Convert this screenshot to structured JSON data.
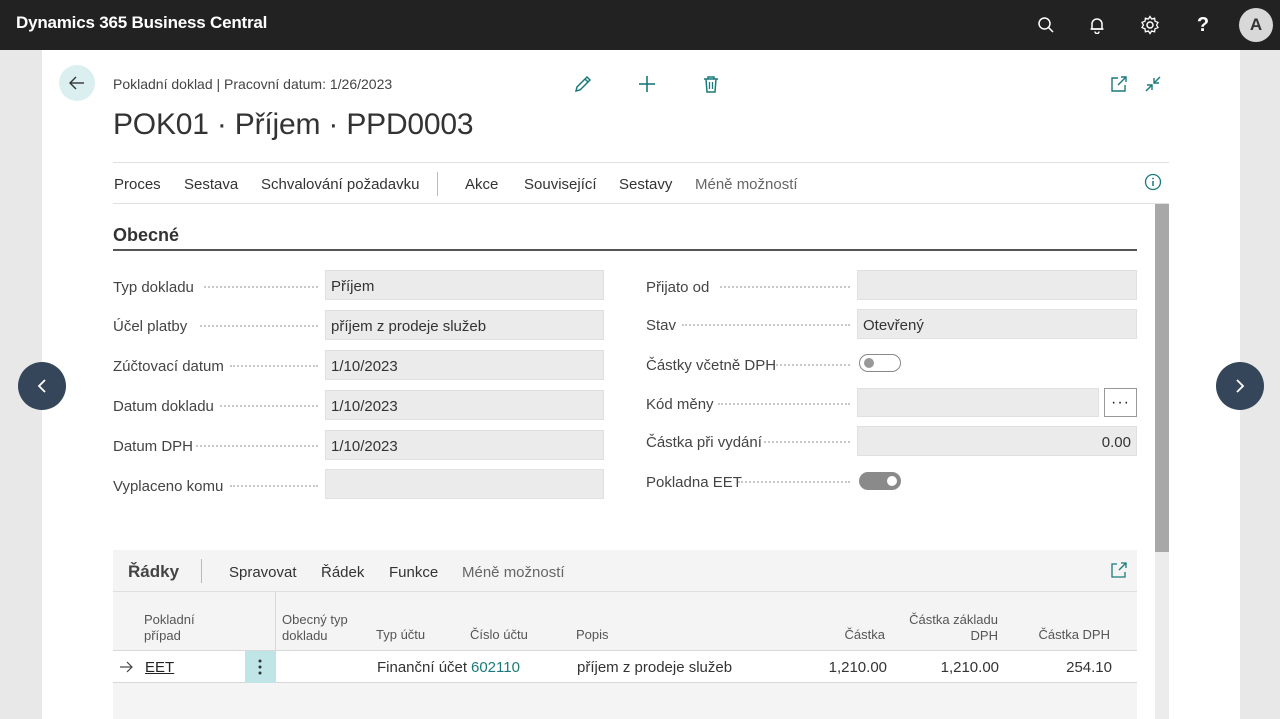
{
  "app": {
    "title": "Dynamics 365 Business Central",
    "avatar_initial": "A"
  },
  "topbar_icons": [
    "search-icon",
    "bell-icon",
    "gear-icon",
    "help-icon"
  ],
  "page": {
    "caption": "Pokladní doklad | Pracovní datum: 1/26/2023",
    "title": "POK01 · Příjem · PPD0003"
  },
  "actions": {
    "menu": [
      "Proces",
      "Sestava",
      "Schvalování požadavku",
      "Akce",
      "Související",
      "Sestavy",
      "Méně možností"
    ]
  },
  "general": {
    "section_title": "Obecné",
    "left_fields": [
      {
        "label": "Typ dokladu",
        "value": "Příjem"
      },
      {
        "label": "Účel platby",
        "value": "příjem z prodeje služeb"
      },
      {
        "label": "Zúčtovací datum",
        "value": "1/10/2023"
      },
      {
        "label": "Datum dokladu",
        "value": "1/10/2023"
      },
      {
        "label": "Datum DPH",
        "value": "1/10/2023"
      },
      {
        "label": "Vyplaceno komu",
        "value": ""
      }
    ],
    "right_fields": [
      {
        "label": "Přijato od",
        "value": ""
      },
      {
        "label": "Stav",
        "value": "Otevřený"
      },
      {
        "label": "Částky včetně DPH",
        "toggle": false
      },
      {
        "label": "Kód měny",
        "value": "",
        "ellipsis": "···"
      },
      {
        "label": "Částka při vydání",
        "value": "0.00"
      },
      {
        "label": "Pokladna EET",
        "toggle": true
      }
    ]
  },
  "lines": {
    "title": "Řádky",
    "menu": [
      "Spravovat",
      "Řádek",
      "Funkce",
      "Méně možností"
    ],
    "columns": {
      "c1a": "Pokladní",
      "c1b": "případ",
      "c2a": "Obecný typ",
      "c2b": "dokladu",
      "c3": "Typ účtu",
      "c4": "Číslo účtu",
      "c5": "Popis",
      "c6": "Částka",
      "c7a": "Částka základu",
      "c7b": "DPH",
      "c8": "Částka DPH"
    },
    "rows": [
      {
        "cash_case": "EET",
        "gen_doc_type": "",
        "account_type": "Finanční účet",
        "account_no": "602110",
        "description": "příjem z prodeje služeb",
        "amount": "1,210.00",
        "vat_base": "1,210.00",
        "vat_amount": "254.10"
      }
    ]
  }
}
